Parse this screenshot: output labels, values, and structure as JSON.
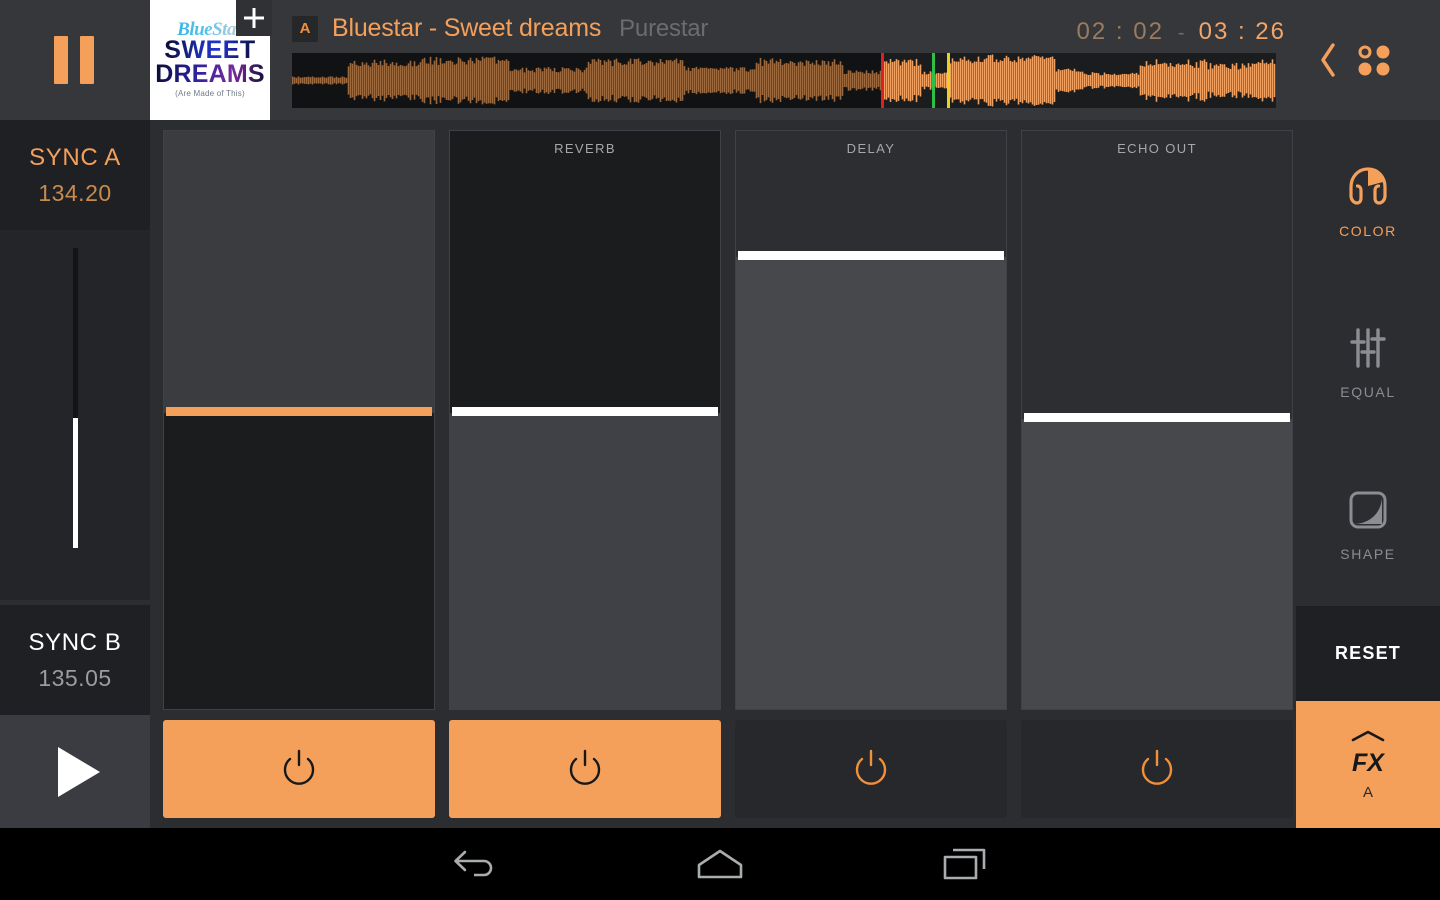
{
  "header": {
    "transport": {
      "pause_icon": "pause-icon"
    },
    "album_art": {
      "line1": "BlueStar",
      "line2": "SWEET",
      "line3": "DREAMS",
      "line4": "(Are Made of This)"
    },
    "add_button": {
      "icon": "plus-icon",
      "label": "+"
    },
    "deck_badge": "A",
    "track_title": "Bluestar - Sweet dreams",
    "track_artist": "Purestar",
    "time_elapsed": "02 : 02",
    "time_separator": "-",
    "time_total": "03 : 26",
    "back_icon": "chevron-left-icon",
    "grid_icon": "grid-dots-icon",
    "waveform": {
      "color": "#f0a060",
      "background": "#1b1c1e",
      "cues": [
        {
          "name": "playhead",
          "color": "#e02020",
          "x_pct": 59.9
        },
        {
          "name": "cue-green",
          "color": "#2fbf46",
          "x_pct": 65.0
        },
        {
          "name": "cue-yellow",
          "color": "#e8d21f",
          "x_pct": 66.6
        }
      ]
    }
  },
  "sync": {
    "a": {
      "label": "SYNC A",
      "bpm": "134.20",
      "color": "#f5a05a"
    },
    "b": {
      "label": "SYNC B",
      "bpm": "135.05",
      "color": "#ffffff"
    },
    "crossfader": {
      "name": "crossfader",
      "value_pct": 58
    },
    "play_icon": "play-icon"
  },
  "fx_sliders": [
    {
      "name": "slider-1",
      "label": "",
      "handle_pct": 49,
      "handle_color": "#f5a05a",
      "upper_color": "#3a3c40",
      "lower_color": "#1b1c1e",
      "box_bg": "#1b1c1e",
      "power": {
        "state": "on",
        "bg": "#f5a05a",
        "icon_color": "#17181a",
        "icon": "power-icon"
      }
    },
    {
      "name": "slider-reverb",
      "label": "REVERB",
      "handle_pct": 49,
      "handle_color": "#ffffff",
      "upper_color": "#1b1c1e",
      "lower_color": "#3f4146",
      "box_bg": "#1b1c1e",
      "power": {
        "state": "on",
        "bg": "#f5a05a",
        "icon_color": "#17181a",
        "icon": "power-icon"
      }
    },
    {
      "name": "slider-delay",
      "label": "DELAY",
      "handle_pct": 22,
      "handle_color": "#ffffff",
      "upper_color": "#2c2e32",
      "lower_color": "#46484c",
      "box_bg": "#2c2e32",
      "power": {
        "state": "off",
        "bg": "#26282b",
        "icon_color": "#f0903a",
        "icon": "power-icon"
      }
    },
    {
      "name": "slider-echo-out",
      "label": "ECHO OUT",
      "handle_pct": 50,
      "handle_color": "#ffffff",
      "upper_color": "#2c2e32",
      "lower_color": "#46484c",
      "box_bg": "#2c2e32",
      "power": {
        "state": "off",
        "bg": "#26282b",
        "icon_color": "#f0903a",
        "icon": "power-icon"
      }
    }
  ],
  "fx_column": {
    "items": [
      {
        "name": "fx-color",
        "label": "COLOR",
        "icon": "color-headphone-icon",
        "color": "#f5a05a",
        "active": true
      },
      {
        "name": "fx-equal",
        "label": "EQUAL",
        "icon": "equalizer-icon",
        "color": "#8b8d92",
        "active": false
      },
      {
        "name": "fx-shape",
        "label": "SHAPE",
        "icon": "shape-curve-icon",
        "color": "#8b8d92",
        "active": false
      }
    ],
    "reset_label": "RESET",
    "panel": {
      "chevron_icon": "chevron-up-icon",
      "text": "FX",
      "deck": "A",
      "bg": "#f5a05a"
    }
  },
  "navbar": {
    "back_icon": "android-back-icon",
    "home_icon": "android-home-icon",
    "recent_icon": "android-recents-icon"
  }
}
